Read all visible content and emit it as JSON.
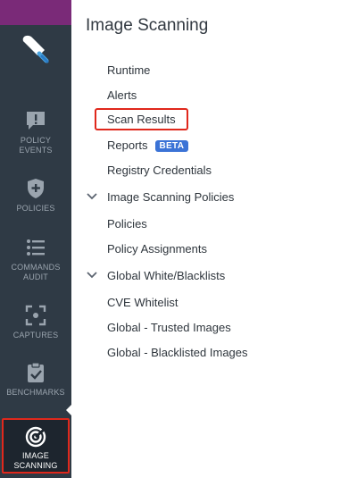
{
  "sidebar": {
    "items": [
      {
        "label_line1": "POLICY",
        "label_line2": "EVENTS",
        "icon": "alert-bubble-icon"
      },
      {
        "label_line1": "POLICIES",
        "label_line2": "",
        "icon": "shield-plus-icon"
      },
      {
        "label_line1": "COMMANDS",
        "label_line2": "AUDIT",
        "icon": "list-icon"
      },
      {
        "label_line1": "CAPTURES",
        "label_line2": "",
        "icon": "capture-frame-icon"
      },
      {
        "label_line1": "BENCHMARKS",
        "label_line2": "",
        "icon": "clipboard-check-icon"
      },
      {
        "label_line1": "IMAGE",
        "label_line2": "SCANNING",
        "icon": "scan-target-icon"
      }
    ],
    "colors": {
      "background": "#2f3a45",
      "topbar": "#7a2a78",
      "highlight": "#e0281c"
    }
  },
  "panel": {
    "title": "Image Scanning",
    "items": {
      "runtime": "Runtime",
      "alerts": "Alerts",
      "scan_results": "Scan Results",
      "reports": "Reports",
      "reports_badge": "BETA",
      "registry_credentials": "Registry Credentials"
    },
    "sections": {
      "policies_header": "Image Scanning Policies",
      "policies": "Policies",
      "policy_assignments": "Policy Assignments",
      "lists_header": "Global White/Blacklists",
      "cve_whitelist": "CVE Whitelist",
      "trusted_images": "Global - Trusted Images",
      "blacklisted_images": "Global - Blacklisted Images"
    },
    "badge_color": "#3b73d6"
  }
}
